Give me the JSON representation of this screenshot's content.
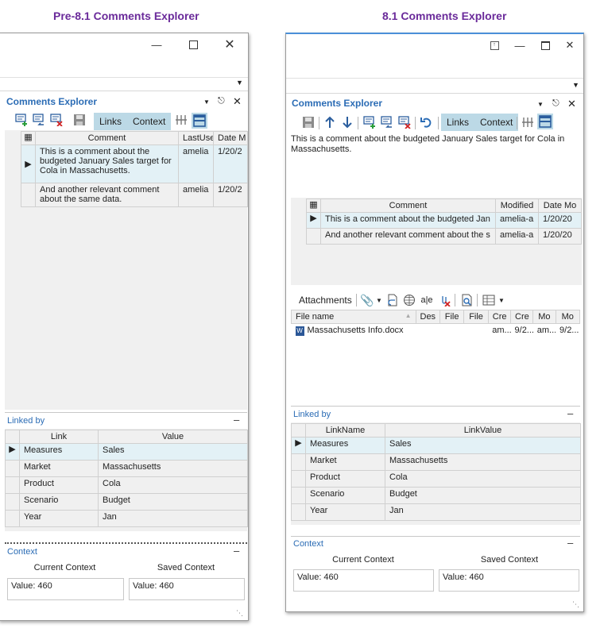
{
  "left": {
    "heading": "Pre-8.1 Comments Explorer",
    "title": "Comments Explorer",
    "toolbar": {
      "links": "Links",
      "context": "Context"
    },
    "comments_grid": {
      "columns": [
        "Comment",
        "LastUse",
        "Date M"
      ],
      "rows": [
        {
          "comment": "This is a comment about the budgeted January Sales target for Cola in Massachusetts.",
          "user": "amelia",
          "date": "1/20/2"
        },
        {
          "comment": "And another relevant comment about the same data.",
          "user": "amelia",
          "date": "1/20/2"
        }
      ]
    },
    "linked_by": {
      "title": "Linked by",
      "columns": [
        "Link",
        "Value"
      ],
      "rows": [
        {
          "link": "Measures",
          "value": "Sales"
        },
        {
          "link": "Market",
          "value": "Massachusetts"
        },
        {
          "link": "Product",
          "value": "Cola"
        },
        {
          "link": "Scenario",
          "value": "Budget"
        },
        {
          "link": "Year",
          "value": "Jan"
        }
      ]
    },
    "context": {
      "title": "Context",
      "current_label": "Current Context",
      "saved_label": "Saved Context",
      "current_value": "Value: 460",
      "saved_value": "Value: 460"
    },
    "minus": "–"
  },
  "right": {
    "heading": "8.1 Comments Explorer",
    "title": "Comments Explorer",
    "toolbar": {
      "links": "Links",
      "context": "Context"
    },
    "comment_text": "This is a comment about the budgeted January Sales target for Cola in Massachusetts.",
    "comments_grid": {
      "columns": [
        "Comment",
        "Modified",
        "Date Mo"
      ],
      "rows": [
        {
          "comment": "This is a comment about the budgeted Jan",
          "user": "amelia-a",
          "date": "1/20/20"
        },
        {
          "comment": "And another relevant comment about the s",
          "user": "amelia-a",
          "date": "1/20/20"
        }
      ]
    },
    "attachments": {
      "label": "Attachments",
      "columns": [
        "File name",
        "Des",
        "File",
        "File",
        "Cre",
        "Cre",
        "Mo",
        "Mo"
      ],
      "rows": [
        {
          "name": "Massachusetts Info.docx",
          "cells": [
            "",
            "",
            "",
            "am...",
            "9/2...",
            "am...",
            "9/2..."
          ]
        }
      ]
    },
    "linked_by": {
      "title": "Linked by",
      "columns": [
        "LinkName",
        "LinkValue"
      ],
      "rows": [
        {
          "link": "Measures",
          "value": "Sales"
        },
        {
          "link": "Market",
          "value": "Massachusetts"
        },
        {
          "link": "Product",
          "value": "Cola"
        },
        {
          "link": "Scenario",
          "value": "Budget"
        },
        {
          "link": "Year",
          "value": "Jan"
        }
      ]
    },
    "context": {
      "title": "Context",
      "current_label": "Current Context",
      "saved_label": "Saved Context",
      "current_value": "Value: 460",
      "saved_value": "Value: 460"
    },
    "minus": "–"
  }
}
